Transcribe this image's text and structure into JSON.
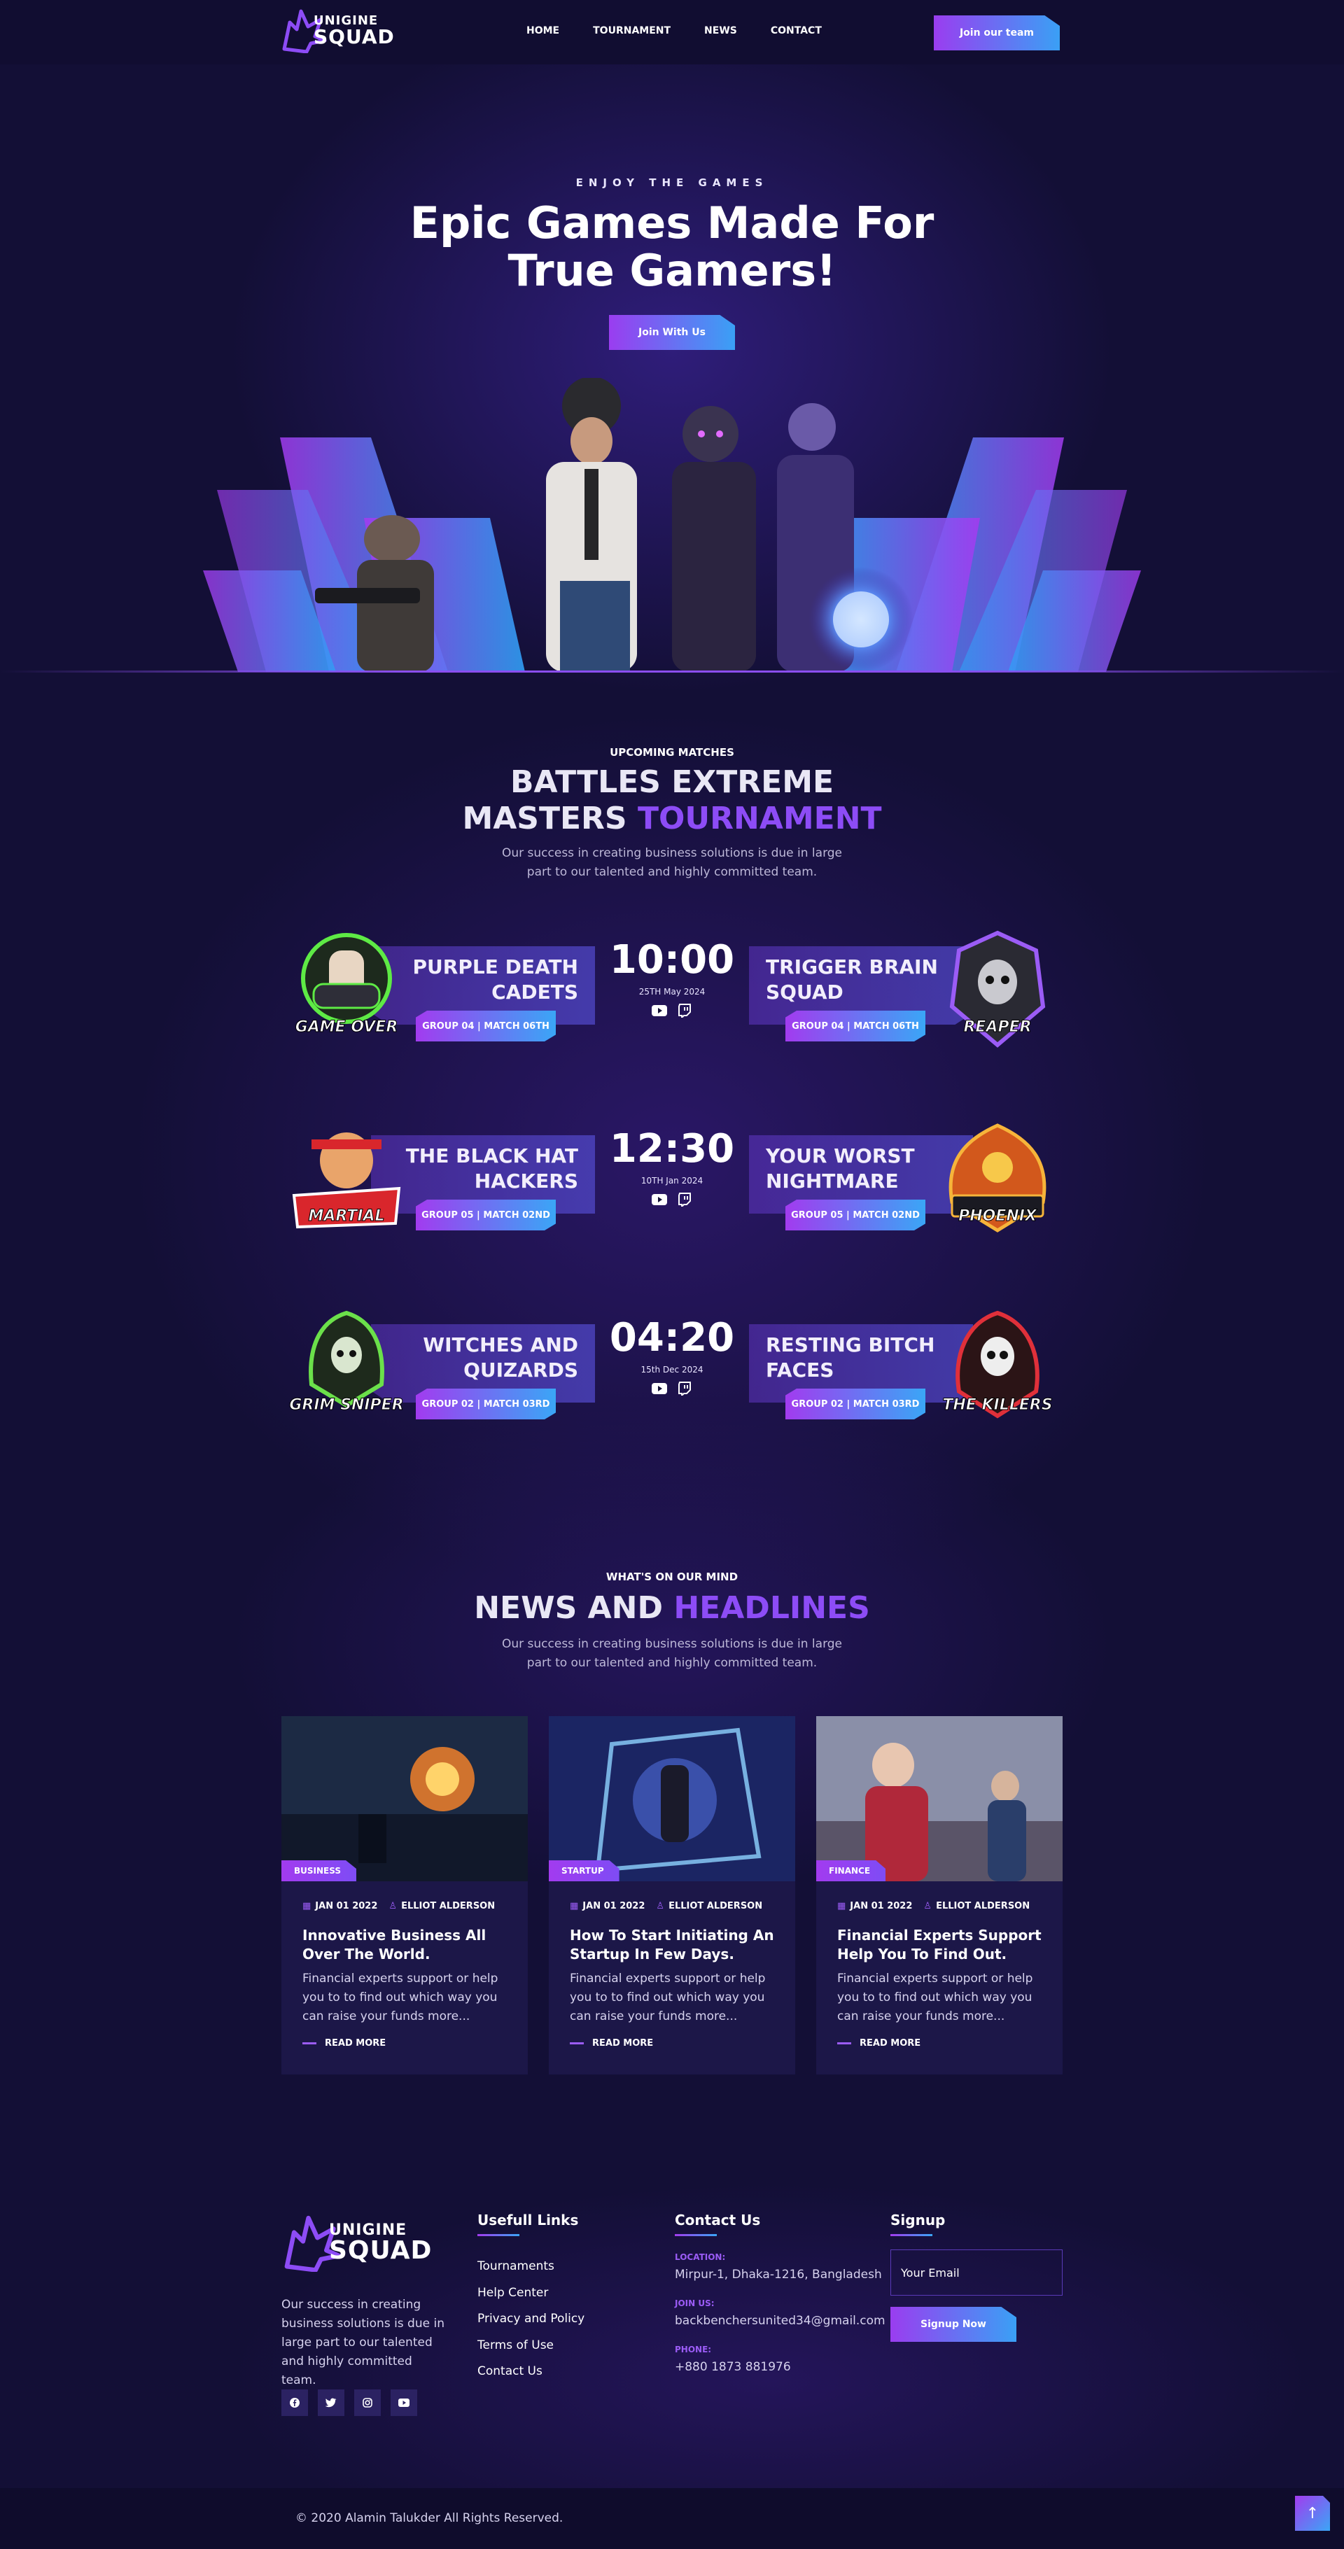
{
  "brand": {
    "line1": "UNIGINE",
    "line2": "SQUAD"
  },
  "nav": {
    "items": [
      "HOME",
      "TOURNAMENT",
      "NEWS",
      "CONTACT"
    ],
    "cta": "Join our team"
  },
  "hero": {
    "kicker": "ENJOY THE GAMES",
    "title": "Epic Games Made For True Gamers!",
    "cta": "Join With Us"
  },
  "matches_section": {
    "kicker": "UPCOMING MATCHES",
    "title_line1": "BATTLES EXTREME",
    "title_line2_plain": "MASTERS",
    "title_line2_accent": "TOURNAMENT",
    "subtitle": "Our success in creating business solutions is due in large part to our talented and highly committed team."
  },
  "matches": [
    {
      "left": {
        "name": "PURPLE DEATH CADETS",
        "group": "GROUP 04 | MATCH 06TH",
        "badge": "GAME OVER"
      },
      "time": "10:00",
      "date": "25TH May 2024",
      "right": {
        "name": "TRIGGER BRAIN SQUAD",
        "group": "GROUP 04 | MATCH 06TH",
        "badge": "REAPER"
      }
    },
    {
      "left": {
        "name": "THE BLACK HAT HACKERS",
        "group": "GROUP 05 | MATCH 02ND",
        "badge": "MARTIAL"
      },
      "time": "12:30",
      "date": "10TH Jan 2024",
      "right": {
        "name": "YOUR WORST NIGHTMARE",
        "group": "GROUP 05 | MATCH 02ND",
        "badge": "PHOENIX"
      }
    },
    {
      "left": {
        "name": "WITCHES AND QUIZARDS",
        "group": "GROUP 02 | MATCH 03RD",
        "badge": "GRIM SNIPER"
      },
      "time": "04:20",
      "date": "15th Dec 2024",
      "right": {
        "name": "RESTING BITCH FACES",
        "group": "GROUP 02 | MATCH 03RD",
        "badge": "THE KILLERS"
      }
    }
  ],
  "news_section": {
    "kicker": "WHAT'S ON OUR MIND",
    "title_plain": "NEWS AND",
    "title_accent": "HEADLINES",
    "subtitle": "Our success in creating business solutions is due in large part to our talented and highly committed team."
  },
  "news": [
    {
      "category": "BUSINESS",
      "date": "JAN 01 2022",
      "author": "ELLIOT ALDERSON",
      "title": "Innovative Business All Over The World.",
      "body": "Financial experts support or help you to to find out which way you can raise your funds more...",
      "more": "READ MORE"
    },
    {
      "category": "STARTUP",
      "date": "JAN 01 2022",
      "author": "ELLIOT ALDERSON",
      "title": "How To Start Initiating An Startup In Few Days.",
      "body": "Financial experts support or help you to to find out which way you can raise your funds more...",
      "more": "READ MORE"
    },
    {
      "category": "FINANCE",
      "date": "JAN 01 2022",
      "author": "ELLIOT ALDERSON",
      "title": "Financial Experts Support Help You To Find Out.",
      "body": "Financial experts support or help you to to find out which way you can raise your funds more...",
      "more": "READ MORE"
    }
  ],
  "footer": {
    "about": "Our success in creating business solutions is due in large part to our talented and highly committed team.",
    "links_title": "Usefull Links",
    "links": [
      "Tournaments",
      "Help Center",
      "Privacy and Policy",
      "Terms of Use",
      "Contact Us"
    ],
    "contact_title": "Contact Us",
    "location_label": "LOCATION:",
    "location": "Mirpur-1, Dhaka-1216, Bangladesh",
    "join_label": "JOIN US:",
    "email": "backbenchersunited34@gmail.com",
    "phone_label": "PHONE:",
    "phone": "+880 1873 881976",
    "signup_title": "Signup",
    "email_placeholder": "Your Email",
    "signup_button": "Signup Now",
    "social": [
      "facebook-icon",
      "twitter-icon",
      "instagram-icon",
      "youtube-icon"
    ],
    "copyright": "© 2020 Alamin Talukder All Rights Reserved."
  },
  "colors": {
    "accent": "#8d4cf6",
    "gradient_start": "#a23bef",
    "gradient_end": "#3aa6f6",
    "bg": "#130f36"
  }
}
